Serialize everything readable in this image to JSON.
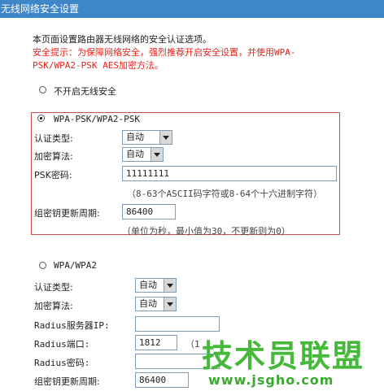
{
  "title": "无线网络安全设置",
  "intro": "本页面设置路由器无线网络的安全认证选项。",
  "tip_line1": "安全提示：为保障网络安全，强烈推荐开启安全设置，并使用WPA-",
  "tip_line2": "PSK/WPA2-PSK AES加密方法。",
  "option_none": {
    "label": "不开启无线安全",
    "selected": false
  },
  "option_psk": {
    "label": "WPA-PSK/WPA2-PSK",
    "selected": true,
    "auth_type_label": "认证类型:",
    "auth_type_value": "自动",
    "encryption_label": "加密算法:",
    "encryption_value": "自动",
    "psk_label": "PSK密码:",
    "psk_value": "11111111",
    "psk_hint": "（8-63个ASCII码字符或8-64个十六进制字符）",
    "rekey_label": "组密钥更新周期:",
    "rekey_value": "86400",
    "rekey_hint": "（单位为秒，最小值为30，不更新则为0）"
  },
  "option_wpa": {
    "label": "WPA/WPA2",
    "selected": false,
    "auth_type_label": "认证类型:",
    "auth_type_value": "自动",
    "encryption_label": "加密算法:",
    "encryption_value": "自动",
    "radius_ip_label": "Radius服务器IP:",
    "radius_ip_value": "",
    "radius_port_label": "Radius端口:",
    "radius_port_value": "1812",
    "radius_port_hint": "（1",
    "radius_pwd_label": "Radius密码:",
    "radius_pwd_value": "",
    "rekey_label": "组密钥更新周期:",
    "rekey_value": "86400"
  },
  "watermark": {
    "text": "技术员联盟",
    "url": "www.jsgho.com"
  }
}
